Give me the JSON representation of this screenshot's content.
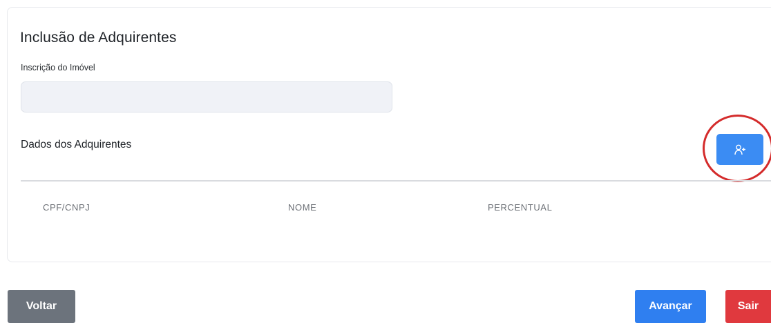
{
  "form": {
    "title": "Inclusão de Adquirentes",
    "inscricao_label": "Inscrição do Imóvel",
    "inscricao_value": "",
    "section_label": "Dados dos Adquirentes",
    "add_button_icon": "add-user-icon"
  },
  "table": {
    "columns": [
      "CPF/CNPJ",
      "NOME",
      "PERCENTUAL"
    ],
    "rows": []
  },
  "actions": {
    "voltar_label": "Voltar",
    "avancar_label": "Avançar",
    "sair_label": "Sair"
  },
  "colors": {
    "primary": "#3b8cf3",
    "secondary": "#6c737c",
    "danger": "#e0393e",
    "highlight": "#d42b2b"
  }
}
